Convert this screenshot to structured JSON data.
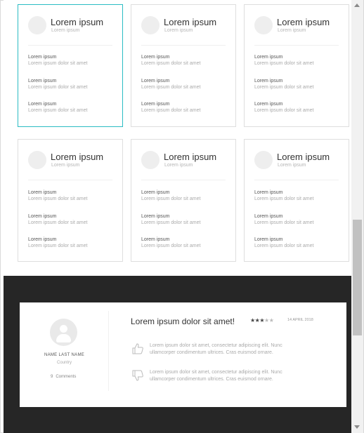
{
  "cards": [
    {
      "title": "Lorem ipsum",
      "subtitle": "Lorem ipsum",
      "items": [
        {
          "label": "Lorem ipsum",
          "value": "Lorem ipsum dolor sit amet"
        },
        {
          "label": "Lorem ipsum",
          "value": "Lorem ipsum dolor sit amet"
        },
        {
          "label": "Lorem ipsum",
          "value": "Lorem ipsum dolor sit amet"
        }
      ]
    },
    {
      "title": "Lorem ipsum",
      "subtitle": "Lorem ipsum",
      "items": [
        {
          "label": "Lorem ipsum",
          "value": "Lorem ipsum dolor sit amet"
        },
        {
          "label": "Lorem ipsum",
          "value": "Lorem ipsum dolor sit amet"
        },
        {
          "label": "Lorem ipsum",
          "value": "Lorem ipsum dolor sit amet"
        }
      ]
    },
    {
      "title": "Lorem ipsum",
      "subtitle": "Lorem ipsum",
      "items": [
        {
          "label": "Lorem ipsum",
          "value": "Lorem ipsum dolor sit amet"
        },
        {
          "label": "Lorem ipsum",
          "value": "Lorem ipsum dolor sit amet"
        },
        {
          "label": "Lorem ipsum",
          "value": "Lorem ipsum dolor sit amet"
        }
      ]
    },
    {
      "title": "Lorem ipsum",
      "subtitle": "Lorem ipsum",
      "items": [
        {
          "label": "Lorem ipsum",
          "value": "Lorem ipsum dolor sit amet"
        },
        {
          "label": "Lorem ipsum",
          "value": "Lorem ipsum dolor sit amet"
        },
        {
          "label": "Lorem ipsum",
          "value": "Lorem ipsum dolor sit amet"
        }
      ]
    },
    {
      "title": "Lorem ipsum",
      "subtitle": "Lorem ipsum",
      "items": [
        {
          "label": "Lorem ipsum",
          "value": "Lorem ipsum dolor sit amet"
        },
        {
          "label": "Lorem ipsum",
          "value": "Lorem ipsum dolor sit amet"
        },
        {
          "label": "Lorem ipsum",
          "value": "Lorem ipsum dolor sit amet"
        }
      ]
    },
    {
      "title": "Lorem ipsum",
      "subtitle": "Lorem ipsum",
      "items": [
        {
          "label": "Lorem ipsum",
          "value": "Lorem ipsum dolor sit amet"
        },
        {
          "label": "Lorem ipsum",
          "value": "Lorem ipsum dolor sit amet"
        },
        {
          "label": "Lorem ipsum",
          "value": "Lorem ipsum dolor sit amet"
        }
      ]
    }
  ],
  "review": {
    "name": "NAME LAST NAME",
    "country": "Country",
    "comments_count": "9",
    "comments_label": "Comments",
    "title": "Lorem ipsum dolor sit amet!",
    "rating": 3,
    "rating_max": 5,
    "stars_on": "★★★",
    "stars_off": "★★",
    "date": "14 APRIL 2018",
    "pro_text": "Lorem ipsum dolor sit amet, consectetur adipiscing elit. Nunc ullamcorper condimentum ultrices. Cras euismod ornare.",
    "con_text": "Lorem ipsum dolor sit amet, consectetur adipiscing elit. Nunc ullamcorper condimentum ultrices. Cras euismod ornare.",
    "icons": {
      "pro": "thumbs-up-icon",
      "con": "thumbs-down-icon",
      "avatar": "user-icon"
    }
  },
  "colors": {
    "active_border": "#2bbcc4",
    "dark_bg": "#262626"
  }
}
